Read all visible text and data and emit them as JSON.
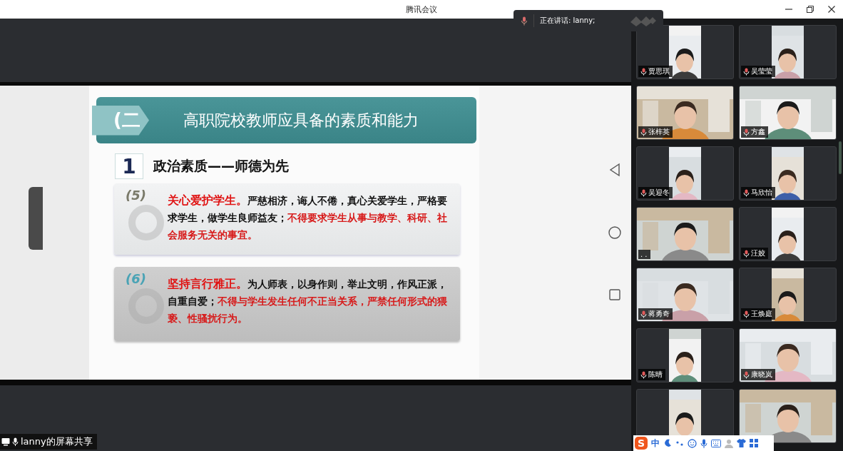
{
  "window": {
    "title": "腾讯会议"
  },
  "speaking_bar": {
    "label": "正在讲话: lanny;"
  },
  "slide": {
    "section_number": "(二",
    "title": "高职院校教师应具备的素质和能力",
    "item_number": "1",
    "item_title": "政治素质——师德为先",
    "points": [
      {
        "number": "(5)",
        "kind": "light",
        "segments": [
          {
            "text": "关心爱护学生。",
            "kind": "highlight"
          },
          {
            "text": "严慈相济，诲人不倦，真心关爱学生，严格要求学生，做学生良师益友；",
            "kind": "plain"
          },
          {
            "text": "不得要求学生从事与教学、科研、社会服务无关的事宜。",
            "kind": "warning"
          }
        ]
      },
      {
        "number": "(6)",
        "kind": "dark",
        "segments": [
          {
            "text": "坚持言行雅正。",
            "kind": "highlight"
          },
          {
            "text": "为人师表，以身作则，举止文明，作风正派，自重自爱；",
            "kind": "plain"
          },
          {
            "text": "不得与学生发生任何不正当关系，严禁任何形式的猥亵、性骚扰行为。",
            "kind": "warning"
          }
        ]
      }
    ]
  },
  "share_label": "lanny的屏幕共享",
  "participants": [
    {
      "name": "贾思琪",
      "kind": "portrait"
    },
    {
      "name": "吴莹莹",
      "kind": "portrait"
    },
    {
      "name": "张梓英",
      "kind": "full"
    },
    {
      "name": "方鑫",
      "kind": "full"
    },
    {
      "name": "吴迎冬",
      "kind": "portrait"
    },
    {
      "name": "马欣怡",
      "kind": "portrait"
    },
    {
      "name": ". .",
      "kind": "full"
    },
    {
      "name": "汪姣",
      "kind": "portrait"
    },
    {
      "name": "蒋勇奇",
      "kind": "full"
    },
    {
      "name": "王焕庭",
      "kind": "portrait"
    },
    {
      "name": "陈晴",
      "kind": "portrait"
    },
    {
      "name": "康晓岚",
      "kind": "full"
    },
    {
      "kind": "portrait"
    },
    {
      "kind": "full"
    }
  ],
  "ime_toolbar": {
    "logo": "S",
    "mode": "中"
  }
}
